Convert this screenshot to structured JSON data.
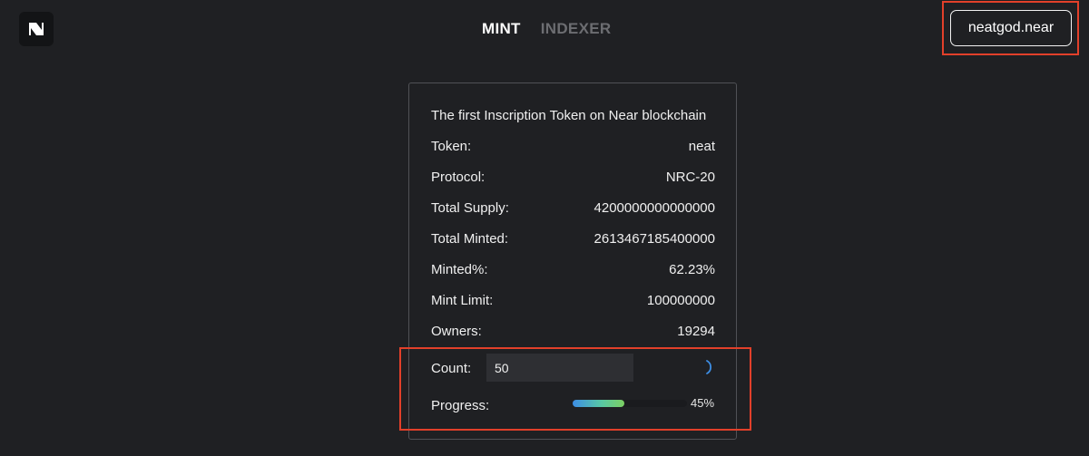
{
  "nav": {
    "logo_icon": "brand-logo-icon",
    "tabs": [
      {
        "label": "MINT",
        "active": true
      },
      {
        "label": "INDEXER",
        "active": false
      }
    ]
  },
  "wallet": {
    "label": "neatgod.near"
  },
  "card": {
    "headline": "The first Inscription Token on Near blockchain",
    "rows": [
      {
        "label": "Token:",
        "value": "neat"
      },
      {
        "label": "Protocol:",
        "value": "NRC-20"
      },
      {
        "label": "Total Supply:",
        "value": "4200000000000000"
      },
      {
        "label": "Total Minted:",
        "value": "2613467185400000"
      },
      {
        "label": "Minted%:",
        "value": "62.23%"
      },
      {
        "label": "Mint Limit:",
        "value": "100000000"
      },
      {
        "label": "Owners:",
        "value": "19294"
      }
    ],
    "count": {
      "label": "Count:",
      "value": "50",
      "spinner_icon": "loading-spinner-icon"
    },
    "progress": {
      "label": "Progress:",
      "percent": 45,
      "value_text": "45%"
    }
  },
  "colors": {
    "background": "#1f2023",
    "annotation": "#e2402a",
    "accent_blue": "#3d8ee5",
    "accent_green": "#7ccf62"
  }
}
